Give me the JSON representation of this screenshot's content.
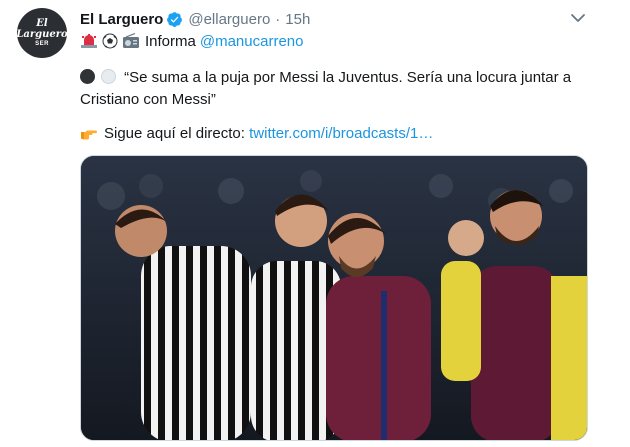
{
  "tweet": {
    "avatar": {
      "line1": "El",
      "line2": "Larguero",
      "line3": "SER"
    },
    "display_name": "El Larguero",
    "handle": "@ellarguero",
    "separator": "·",
    "time": "15h",
    "informa_label": "Informa",
    "mention": "@manucarreno",
    "quote": "“Se suma a la puja por Messi la Juventus. Sería una locura juntar a Cristiano con Messi”",
    "follow_text": "Sigue aquí el directo:",
    "link_text": "twitter.com/i/broadcasts/1…"
  },
  "colors": {
    "link": "#1b95e0",
    "verified": "#1da1f2",
    "muted": "#657786",
    "text": "#14171a"
  },
  "icons": [
    "verified-badge-icon",
    "chevron-down-icon",
    "siren-icon",
    "soccer-ball-icon",
    "radio-icon",
    "black-circle-icon",
    "white-circle-icon",
    "pointing-hand-icon"
  ]
}
